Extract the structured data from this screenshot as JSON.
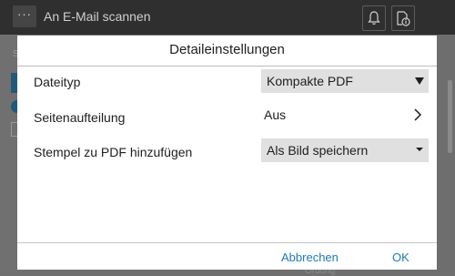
{
  "topbar": {
    "menu_icon_label": "···",
    "title": "An  E-Mail  scannen",
    "icons": [
      "bell-icon",
      "document-info-icon"
    ]
  },
  "background": {
    "left_nav_glyph": "S",
    "bottom_partial_text": "Ordung"
  },
  "dialog": {
    "title": "Detaileinstellungen",
    "rows": [
      {
        "label": "Dateityp",
        "value": "Kompakte  PDF",
        "control": "select"
      },
      {
        "label": "Seitenaufteilung",
        "value": "Aus",
        "control": "link"
      },
      {
        "label": "Stempel zu PDF hinzufügen",
        "value": "Als Bild speichern",
        "control": "select"
      }
    ],
    "cancel_label": "Abbrechen",
    "ok_label": "OK"
  },
  "colors": {
    "topbar": "#2f2f2f",
    "dim_overlay": "#6f6f6f",
    "select_bg": "#e0e0e0",
    "accent_link": "#1e7ab8"
  }
}
